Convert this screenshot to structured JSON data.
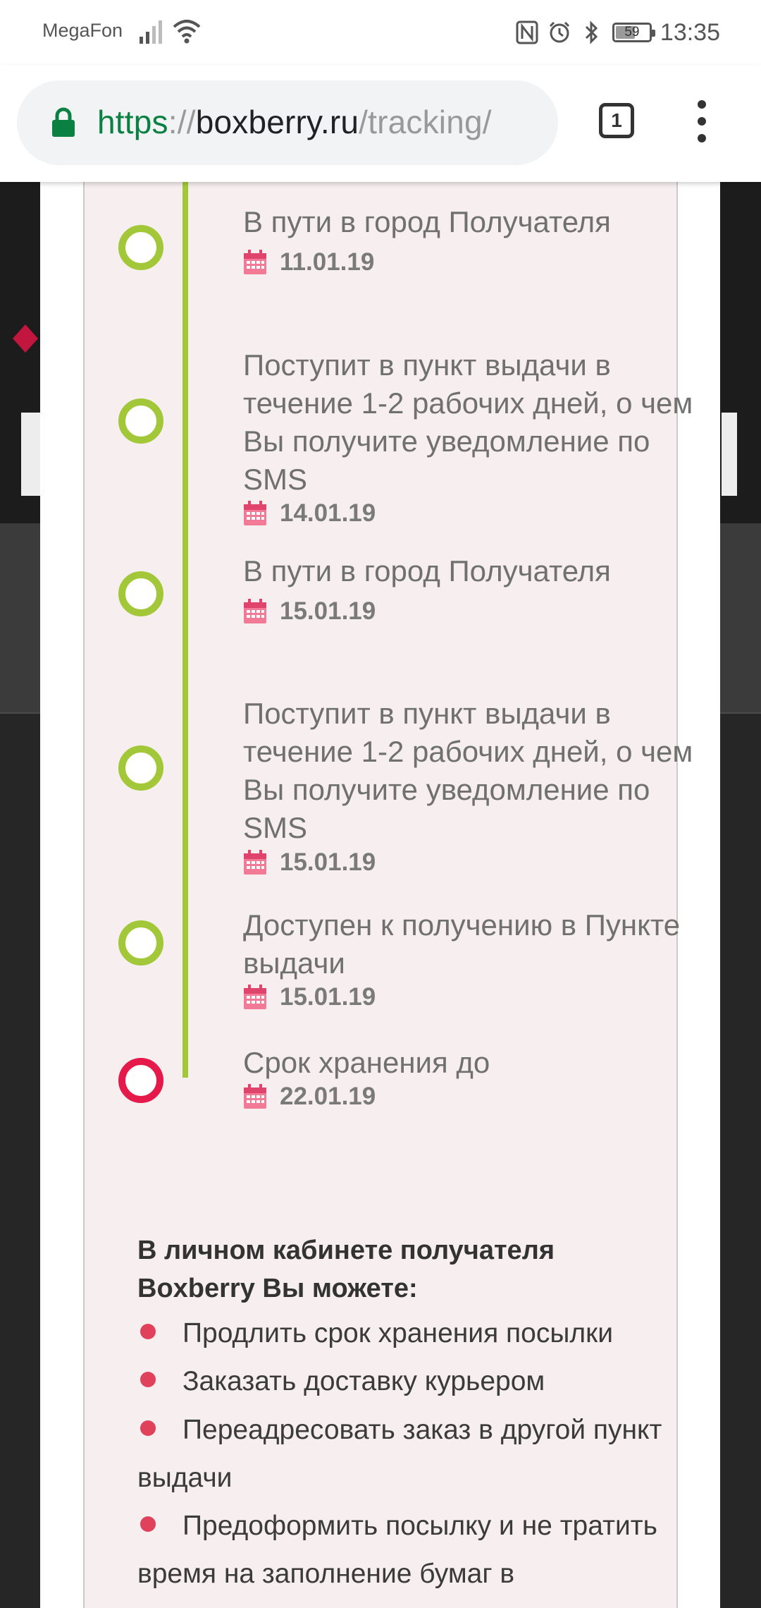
{
  "status_bar": {
    "carrier": "MegaFon",
    "battery": "59",
    "time": "13:35",
    "icons": [
      "signal-icon",
      "wifi-icon",
      "nfc-icon",
      "alarm-icon",
      "bluetooth-icon",
      "battery-icon"
    ]
  },
  "browser": {
    "url_scheme": "https",
    "url_separator": "://",
    "url_host": "boxberry.ru",
    "url_path": "/tracking/",
    "tab_count": "1",
    "accent_color": "#0b8043"
  },
  "timeline": {
    "line_color": "#a2c83a",
    "final_color": "#e5194a",
    "events": [
      {
        "title": "В пути в город Получателя",
        "date": "11.01.19"
      },
      {
        "title": "Поступит в пункт выдачи в течение 1-2 рабочих дней, о чем Вы получите уведомление по SMS",
        "date": "14.01.19"
      },
      {
        "title": "В пути в город Получателя",
        "date": "15.01.19"
      },
      {
        "title": "Поступит в пункт выдачи в течение 1-2 рабочих дней, о чем Вы получите уведомление по SMS",
        "date": "15.01.19"
      },
      {
        "title": "Доступен к получению в Пункте выдачи",
        "date": "15.01.19"
      },
      {
        "title": "Срок хранения до",
        "date": "22.01.19"
      }
    ]
  },
  "cabinet": {
    "title_line1": "В личном кабинете получателя",
    "title_line2": "Boxberry Вы можете:",
    "features": [
      "Продлить срок хранения посылки",
      "Заказать доставку курьером",
      "Переадресовать заказ в другой пункт выдачи",
      "Предоформить посылку и не тратить время на заполнение бумаг в"
    ]
  }
}
